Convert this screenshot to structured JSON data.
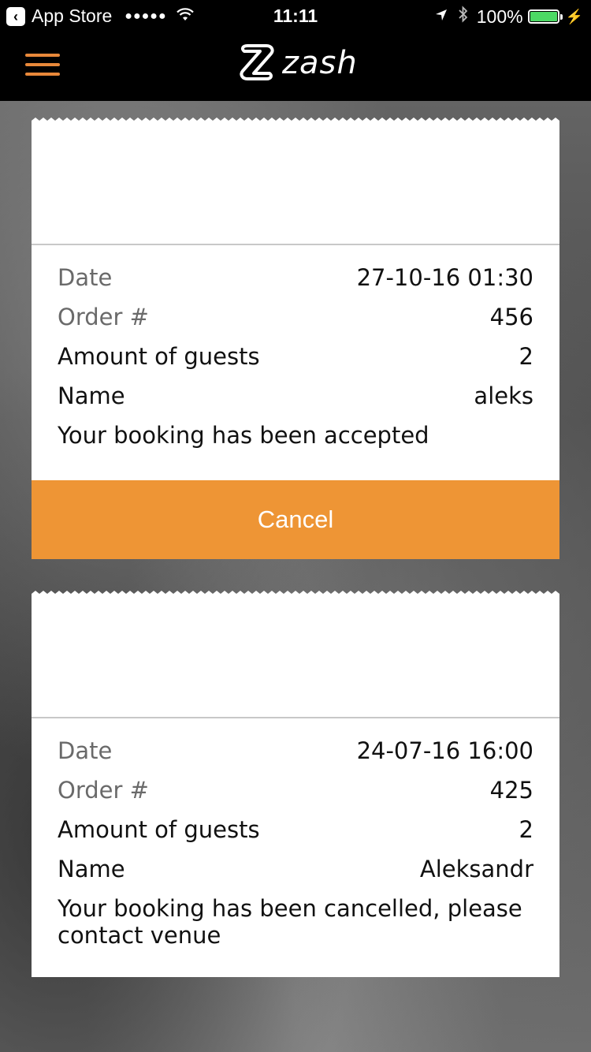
{
  "status_bar": {
    "back_app": "App Store",
    "time": "11:11",
    "battery_percent": "100%",
    "battery_color": "#4cd964"
  },
  "nav": {
    "logo_text": "zash",
    "menu_icon": "hamburger-menu-icon",
    "accent_color": "#e8883a"
  },
  "bookings": [
    {
      "rows": [
        {
          "label": "Date",
          "value": "27-10-16 01:30"
        },
        {
          "label": "Order #",
          "value": "456"
        },
        {
          "label": "Amount of guests",
          "value": "2"
        },
        {
          "label": "Name",
          "value": "aleks"
        }
      ],
      "message": "Your booking has been accepted",
      "action_label": "Cancel"
    },
    {
      "rows": [
        {
          "label": "Date",
          "value": "24-07-16 16:00"
        },
        {
          "label": "Order #",
          "value": "425"
        },
        {
          "label": "Amount of guests",
          "value": "2"
        },
        {
          "label": "Name",
          "value": "Aleksandr"
        }
      ],
      "message": "Your booking has been cancelled, please contact venue"
    }
  ]
}
